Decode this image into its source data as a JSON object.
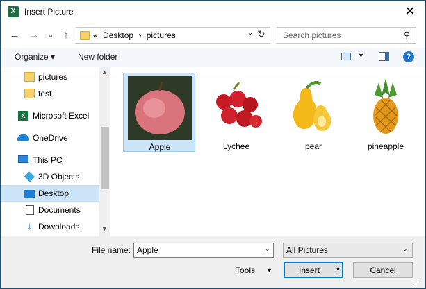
{
  "window": {
    "title": "Insert Picture",
    "app_icon": "X"
  },
  "nav": {
    "back": "←",
    "forward": "→",
    "recent": "⌄",
    "up": "↑"
  },
  "address": {
    "overflow": "«",
    "crumbs": [
      "Desktop",
      "pictures"
    ],
    "sep": "›"
  },
  "search": {
    "placeholder": "Search pictures"
  },
  "toolbar": {
    "organize": "Organize ▾",
    "new_folder": "New folder",
    "help": "?"
  },
  "sidebar": {
    "items": [
      {
        "label": "pictures",
        "icon": "folder-icon"
      },
      {
        "label": "test",
        "icon": "folder-icon"
      },
      {
        "label": "Microsoft Excel",
        "icon": "excel-icon"
      },
      {
        "label": "OneDrive",
        "icon": "onedrive-icon"
      },
      {
        "label": "This PC",
        "icon": "this-pc-icon"
      },
      {
        "label": "3D Objects",
        "icon": "3d-objects-icon"
      },
      {
        "label": "Desktop",
        "icon": "desktop-icon",
        "selected": true
      },
      {
        "label": "Documents",
        "icon": "documents-icon"
      },
      {
        "label": "Downloads",
        "icon": "downloads-icon"
      }
    ]
  },
  "files": [
    {
      "name": "Apple",
      "selected": true
    },
    {
      "name": "Lychee"
    },
    {
      "name": "pear"
    },
    {
      "name": "pineapple"
    }
  ],
  "footer": {
    "file_name_label": "File name:",
    "file_name_value": "Apple",
    "filter_value": "All Pictures",
    "tools": "Tools",
    "insert": "Insert",
    "cancel": "Cancel"
  },
  "colors": {
    "selection": "#cce4f7",
    "accent": "#0078d7"
  }
}
